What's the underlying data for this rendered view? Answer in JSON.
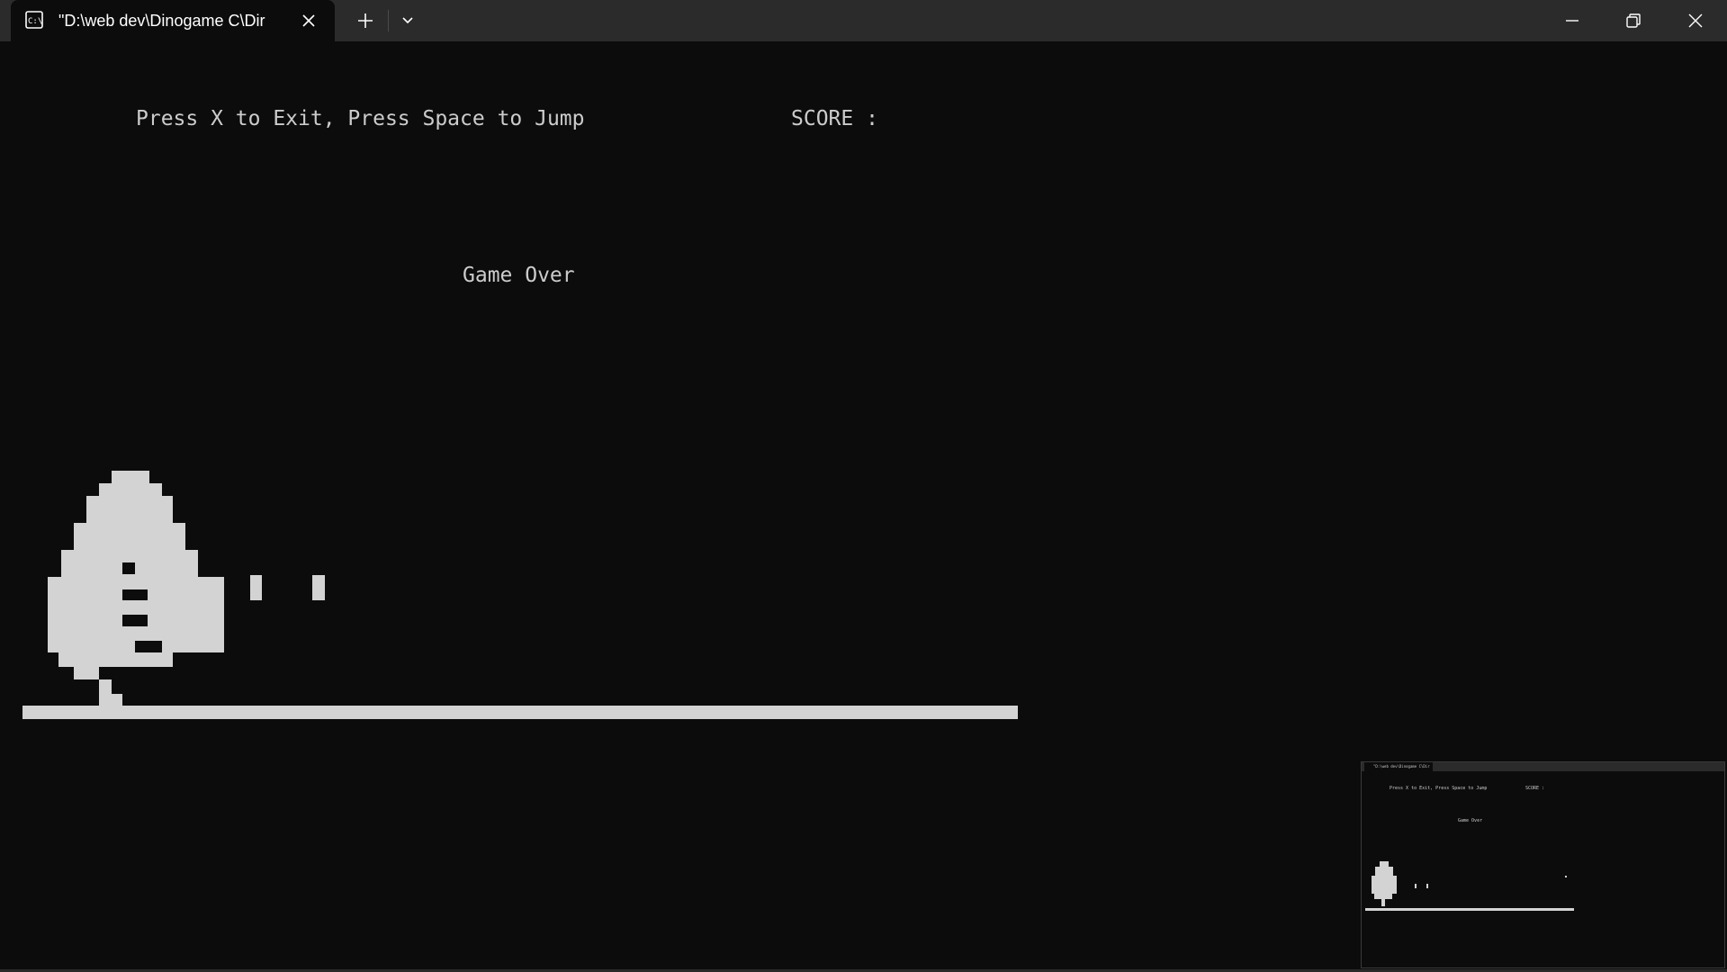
{
  "window": {
    "tab_title": "\"D:\\web dev\\Dinogame C\\Dir",
    "controls": {
      "new_tab_icon": "plus-icon",
      "dropdown_icon": "chevron-down-icon",
      "minimize_icon": "minimize-icon",
      "restore_icon": "restore-icon",
      "close_icon": "close-icon"
    }
  },
  "terminal": {
    "instructions": "Press X to Exit, Press Space to Jump",
    "score_label": "SCORE :",
    "game_over": "Game Over",
    "colors": {
      "background": "#0c0c0c",
      "text": "#cccccc",
      "sprite": "#d3d3d3"
    }
  },
  "thumbnail": {
    "tab_title": "\"D:\\web dev\\Dinogame C\\Dir",
    "instructions": "Press X to Exit, Press Space to Jump",
    "score_label": "SCORE :",
    "game_over": "Game Over"
  }
}
